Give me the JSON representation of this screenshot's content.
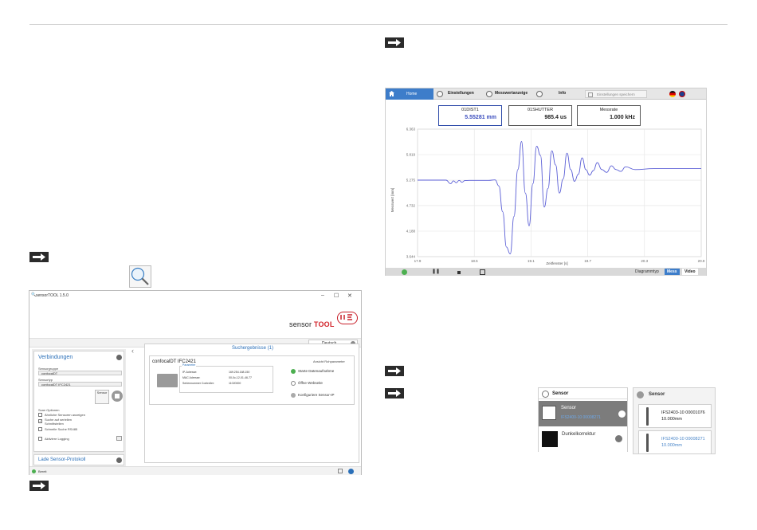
{
  "doc": {
    "step_arrow": "right-arrow"
  },
  "sensor_tool": {
    "window_title": "sensorTOOL 1.5.0",
    "window_controls": [
      "–",
      "☐",
      "✕"
    ],
    "brand_prefix": "sensor",
    "brand_suffix": "TOOL",
    "language": "Deutsch",
    "connections": {
      "title": "Verbindungen",
      "sensor_group_label": "Sensorgruppe",
      "sensor_group_value": "confocalDT",
      "sensor_type_label": "Sensortyp",
      "sensor_type_value": "confocalDT IFC2421",
      "search_button": "Sensor",
      "scan_options_label": "Scan Optionen",
      "options": [
        {
          "label": "Ähnliche Sensoren anzeigen",
          "checked": false
        },
        {
          "label": "Suche auf seriellen Schnittstellen",
          "checked": true
        },
        {
          "label": "Schnelle Suche RS485",
          "checked": false
        },
        {
          "label": "Aktiviere Logging",
          "checked": false
        }
      ]
    },
    "load_protocol": "Lade Sensor-Protokoll",
    "results_title": "Suchergebnisse (1)",
    "device": {
      "name": "confocalDT IFC2421",
      "raw_params_link": "Ansicht Rohparameter",
      "params_legend": "Parameter",
      "params": [
        {
          "key": "IP-Adresse:",
          "value": "169.254.168.150"
        },
        {
          "key": "MAC Adresse:",
          "value": "00-0c-12-01-46-77"
        },
        {
          "key": "Seriennummer Controller:",
          "value": "11020000"
        }
      ],
      "actions": [
        "Starte Datenaufnahme",
        "Öffne Webseite",
        "Konfiguriere Sensor-IP"
      ]
    },
    "status": "Bereit"
  },
  "web_ui": {
    "nav": {
      "home": "Home",
      "settings": "Einstellungen",
      "measurement": "Messwertanzeige",
      "info": "Info",
      "save": "Einstellungen speichern"
    },
    "measurements": [
      {
        "name": "01DIST1",
        "value": "5.55281 mm"
      },
      {
        "name": "01SHUTTER",
        "value": "985.4 us"
      },
      {
        "name": "Messrate",
        "value": "1.000 kHz"
      }
    ],
    "diagram_type_label": "Diagrammtyp",
    "diagram_buttons": [
      "Mess",
      "Video"
    ],
    "colors": {
      "accent": "#3d7dca",
      "series": "#5b5fd6"
    }
  },
  "chart_data": {
    "type": "line",
    "title": "",
    "xlabel": "Zeitfenster [s]",
    "ylabel": "Messwert [mm]",
    "xlim": [
      17.9,
      20.9
    ],
    "ylim": [
      3.644,
      6.363
    ],
    "x_ticks": [
      "17.9",
      "18.5",
      "19.1",
      "19.7",
      "20.3",
      "20.9"
    ],
    "y_ticks": [
      "6.363",
      "5.819",
      "5.275",
      "4.732",
      "4.188",
      "3.644"
    ],
    "series": [
      {
        "x": [
          17.9,
          18.2,
          18.25,
          18.28,
          18.31,
          18.34,
          18.37,
          18.4,
          18.45,
          18.55,
          18.65,
          18.72,
          18.76,
          18.8,
          18.84,
          18.88,
          18.92,
          18.96,
          19.0,
          19.04,
          19.08,
          19.12,
          19.16,
          19.2,
          19.24,
          19.28,
          19.32,
          19.36,
          19.4,
          19.44,
          19.48,
          19.52,
          19.56,
          19.6,
          19.64,
          19.68,
          19.72,
          19.76,
          19.8,
          19.85,
          19.9,
          19.95,
          20.0,
          20.05,
          20.1,
          20.2,
          20.4,
          20.6,
          20.8,
          20.9
        ],
        "y": [
          5.275,
          5.275,
          5.2,
          5.26,
          5.22,
          5.27,
          5.23,
          5.265,
          5.27,
          5.27,
          5.27,
          5.28,
          5.15,
          4.6,
          3.85,
          3.7,
          4.5,
          5.5,
          6.1,
          5.0,
          4.3,
          5.2,
          6.0,
          5.8,
          4.7,
          5.1,
          5.9,
          5.6,
          5.0,
          5.3,
          5.85,
          5.5,
          5.25,
          5.4,
          5.75,
          5.5,
          5.38,
          5.48,
          5.65,
          5.5,
          5.44,
          5.58,
          5.5,
          5.46,
          5.56,
          5.5,
          5.52,
          5.52,
          5.52,
          5.52
        ]
      }
    ],
    "grid": true,
    "legend": "none"
  },
  "sensor_panel": {
    "left_title": "Sensor",
    "sensor_item": {
      "title": "Sensor",
      "subtitle": "IFS2400-10 00008271"
    },
    "dark_item": {
      "title": "Dunkelkorrektur"
    },
    "right_title": "Sensor",
    "sensors": [
      {
        "id": "IFS2403-10 00001076",
        "range": "10.000mm",
        "selected": false
      },
      {
        "id": "IFS2400-10 00008271",
        "range": "10.000mm",
        "selected": true
      }
    ]
  }
}
